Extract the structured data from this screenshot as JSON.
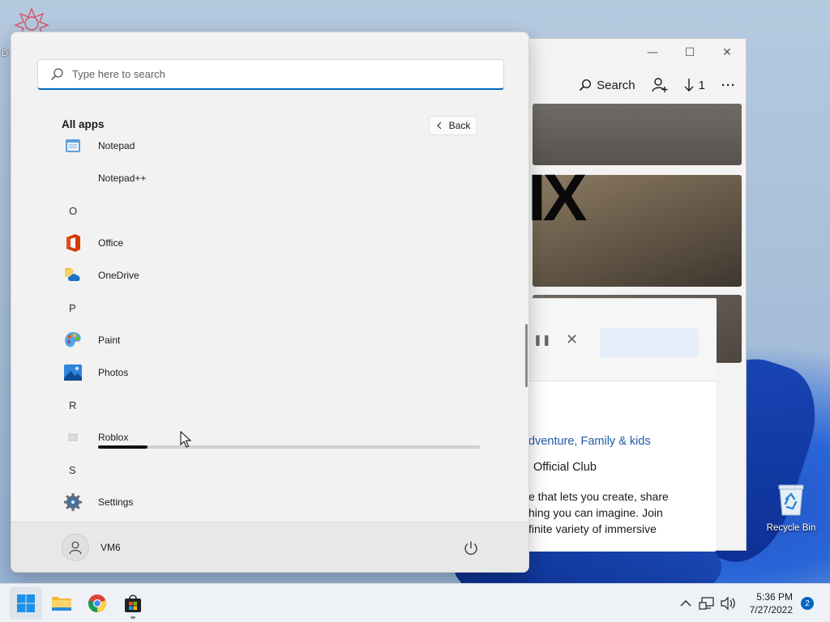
{
  "desktop": {
    "top_left_icon_label": "D",
    "recycle_bin_label": "Recycle Bin"
  },
  "store_window": {
    "controls": {
      "minimize": "—",
      "maximize": "☐",
      "close": "✕"
    },
    "toolbar": {
      "search_label": "Search",
      "downloads_count": "1",
      "more": "···"
    },
    "hero_text": "IX",
    "panel": {
      "genres": "dventure,  Family & kids",
      "club": "Official Club",
      "desc_line1": "e that lets you create, share",
      "desc_line2": "hing you can imagine. Join",
      "desc_line3": "finite variety of immersive"
    }
  },
  "start_menu": {
    "search_placeholder": "Type here to search",
    "section_title": "All apps",
    "back_label": "Back",
    "items": [
      {
        "type": "app",
        "label": "Notepad",
        "icon": "notepad-icon"
      },
      {
        "type": "app",
        "label": "Notepad++",
        "icon": "none"
      },
      {
        "type": "letter",
        "label": "O"
      },
      {
        "type": "app",
        "label": "Office",
        "icon": "office-icon"
      },
      {
        "type": "app",
        "label": "OneDrive",
        "icon": "onedrive-icon"
      },
      {
        "type": "letter",
        "label": "P"
      },
      {
        "type": "app",
        "label": "Paint",
        "icon": "paint-icon"
      },
      {
        "type": "app",
        "label": "Photos",
        "icon": "photos-icon"
      },
      {
        "type": "letter",
        "label": "R"
      },
      {
        "type": "app",
        "label": "Roblox",
        "icon": "roblox-icon"
      },
      {
        "type": "letter",
        "label": "S"
      },
      {
        "type": "app",
        "label": "Settings",
        "icon": "settings-icon"
      }
    ],
    "install_progress": 0.13,
    "user_name": "VM6"
  },
  "taskbar": {
    "apps": [
      "start-icon",
      "file-explorer-icon",
      "chrome-icon",
      "store-icon"
    ],
    "time": "5:36 PM",
    "date": "7/27/2022",
    "notification_count": "2"
  }
}
